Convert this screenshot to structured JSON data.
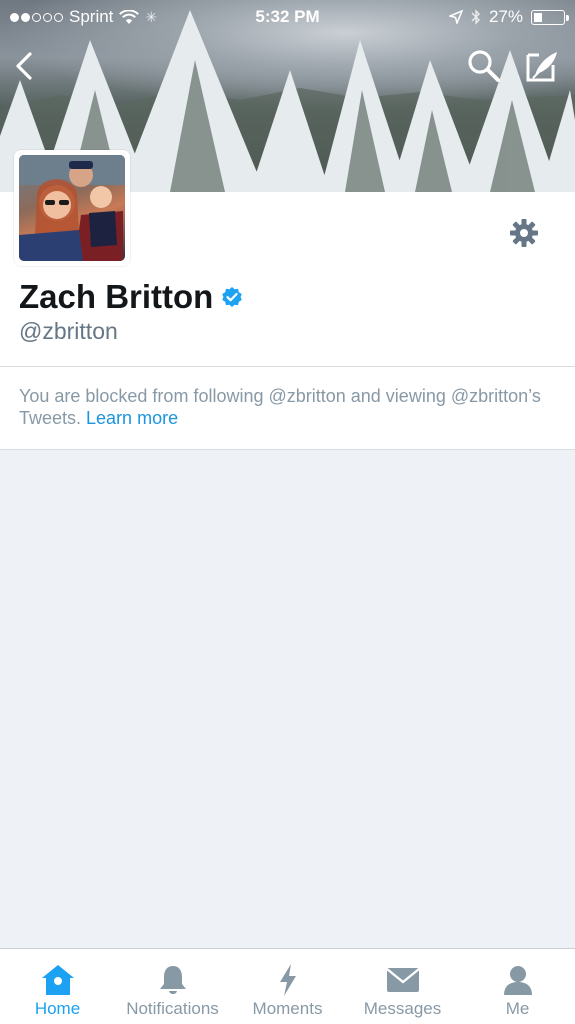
{
  "status_bar": {
    "carrier": "Sprint",
    "time": "5:32 PM",
    "battery_percent": "27%",
    "battery_level": 0.27,
    "signal_bars_filled": 2,
    "signal_bars_total": 5
  },
  "nav": {
    "back_icon": "chevron-left-icon",
    "search_icon": "search-icon",
    "compose_icon": "compose-icon"
  },
  "profile": {
    "name": "Zach Britton",
    "handle": "@zbritton",
    "verified": true,
    "settings_icon": "gear-icon"
  },
  "notice": {
    "text": "You are blocked from following @zbritton and viewing @zbritton’s Tweets.",
    "link": "Learn more"
  },
  "tabs": [
    {
      "label": "Home",
      "icon": "home-icon",
      "active": true
    },
    {
      "label": "Notifications",
      "icon": "bell-icon",
      "active": false
    },
    {
      "label": "Moments",
      "icon": "lightning-icon",
      "active": false
    },
    {
      "label": "Messages",
      "icon": "envelope-icon",
      "active": false
    },
    {
      "label": "Me",
      "icon": "person-icon",
      "active": false
    }
  ],
  "colors": {
    "accent": "#1da1f2",
    "link": "#1b95e0",
    "muted": "#8899a6",
    "text": "#14171a",
    "background": "#eef2f6"
  }
}
